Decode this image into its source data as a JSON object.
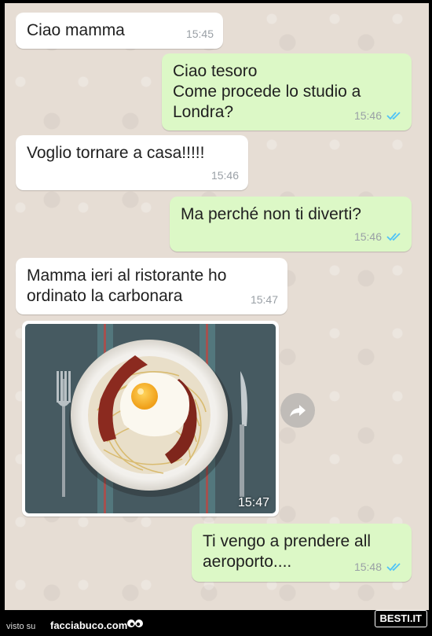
{
  "messages": [
    {
      "direction": "incoming",
      "text": "Ciao mamma",
      "time": "15:45"
    },
    {
      "direction": "outgoing",
      "text": "Ciao tesoro\nCome procede lo studio a\nLondra?",
      "time": "15:46",
      "status": "read"
    },
    {
      "direction": "incoming",
      "text": "Voglio tornare a casa!!!!!",
      "time": "15:46"
    },
    {
      "direction": "outgoing",
      "text": "Ma perché non ti diverti?",
      "time": "15:46",
      "status": "read"
    },
    {
      "direction": "incoming",
      "text": "Mamma ieri al ristorante ho\nordinato la carbonara",
      "time": "15:47"
    },
    {
      "direction": "incoming",
      "type": "photo",
      "time": "15:47"
    },
    {
      "direction": "outgoing",
      "text": "Ti vengo a prendere all\naeroporto....",
      "time": "15:48",
      "status": "read"
    }
  ],
  "icons": {
    "read_receipt": "double-check-icon",
    "forward": "share-arrow-icon"
  },
  "colors": {
    "incoming_bubble": "#ffffff",
    "outgoing_bubble": "#dcf8c6",
    "read_tick": "#4fc3f7",
    "chat_background": "#e6ddd4"
  },
  "footer": {
    "visto_su": "visto su",
    "site": "facciabuco.com",
    "badge": "BESTI.IT"
  }
}
